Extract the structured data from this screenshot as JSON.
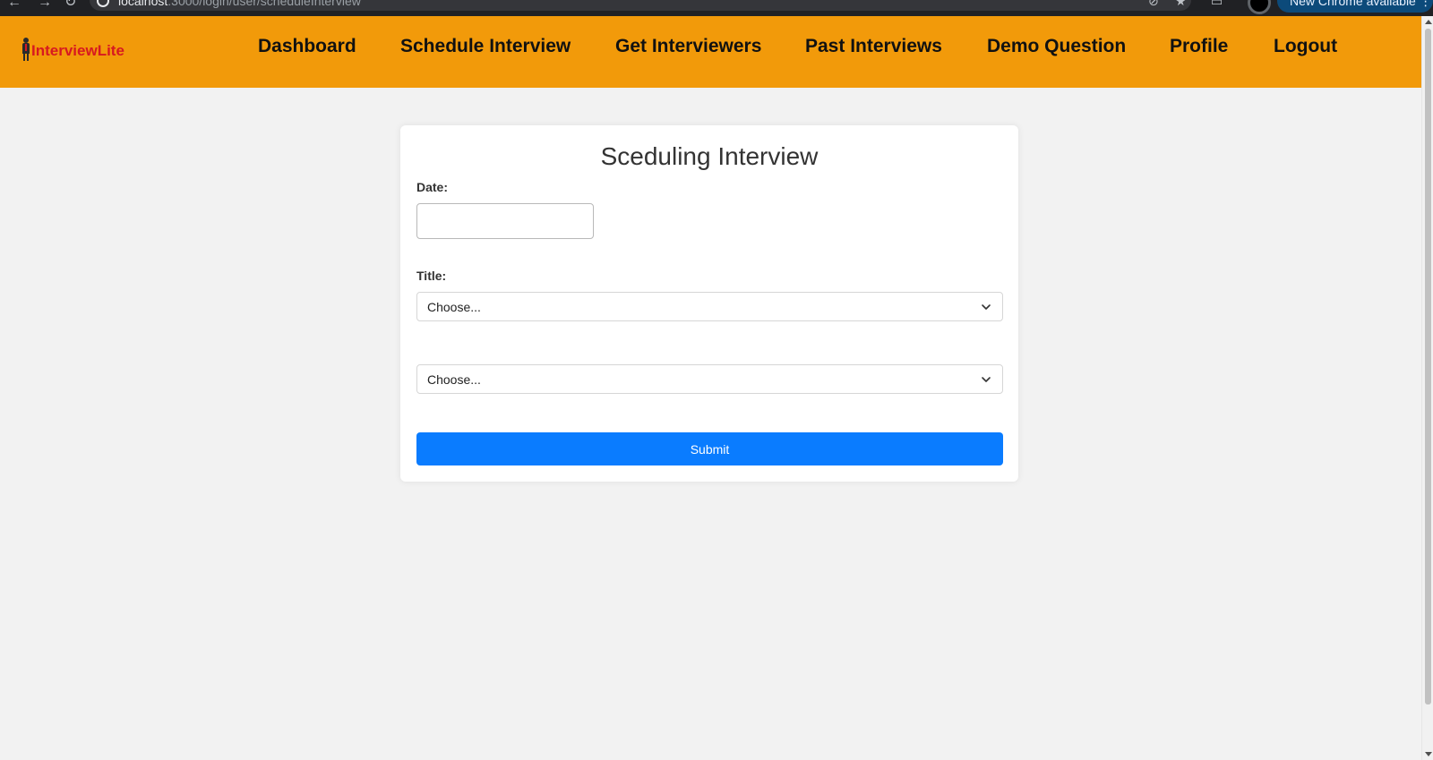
{
  "browser": {
    "url_host": "localhost",
    "url_rest": ":3000/login/user/scheduleInterview",
    "update_label": "New Chrome available"
  },
  "app": {
    "logo_text": "InterviewLite"
  },
  "nav": {
    "items": [
      {
        "label": "Dashboard"
      },
      {
        "label": "Schedule Interview"
      },
      {
        "label": "Get Interviewers"
      },
      {
        "label": "Past Interviews"
      },
      {
        "label": "Demo Question"
      },
      {
        "label": "Profile"
      },
      {
        "label": "Logout"
      }
    ]
  },
  "form": {
    "title": "Sceduling Interview",
    "date_label": "Date:",
    "date_value": "",
    "title_label": "Title:",
    "title_select_value": "Choose...",
    "second_select_value": "Choose...",
    "submit_label": "Submit"
  },
  "colors": {
    "navbar": "#f29a0a",
    "logo_text": "#d71920",
    "submit": "#0a7cff",
    "page_bg": "#f2f2f2"
  }
}
